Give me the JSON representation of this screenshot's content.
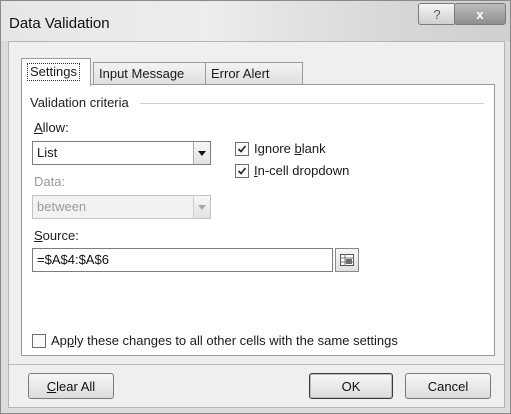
{
  "window": {
    "title": "Data Validation",
    "help_glyph": "?",
    "close_glyph": "x"
  },
  "tabs": [
    {
      "label": "Settings",
      "active": true
    },
    {
      "label": "Input Message",
      "active": false
    },
    {
      "label": "Error Alert",
      "active": false
    }
  ],
  "settings": {
    "group_label": "Validation criteria",
    "allow": {
      "label_prefix": "",
      "label_accel": "A",
      "label_rest": "llow:",
      "value": "List"
    },
    "ignore_blank": {
      "label_prefix": "Ignore ",
      "label_accel": "b",
      "label_rest": "lank",
      "checked": true
    },
    "in_cell_dropdown": {
      "label_prefix": "",
      "label_accel": "I",
      "label_rest": "n-cell dropdown",
      "checked": true
    },
    "data": {
      "label": "Data:",
      "value": "between",
      "disabled": true
    },
    "source": {
      "label_prefix": "",
      "label_accel": "S",
      "label_rest": "ource:",
      "value": "=$A$4:$A$6"
    },
    "apply_all": {
      "label_prefix": "Ap",
      "label_accel": "p",
      "label_rest": "ly these changes to all other cells with the same settings",
      "checked": false
    }
  },
  "buttons": {
    "clear_all": {
      "label_prefix": "",
      "label_accel": "C",
      "label_rest": "lear All"
    },
    "ok": "OK",
    "cancel": "Cancel"
  }
}
